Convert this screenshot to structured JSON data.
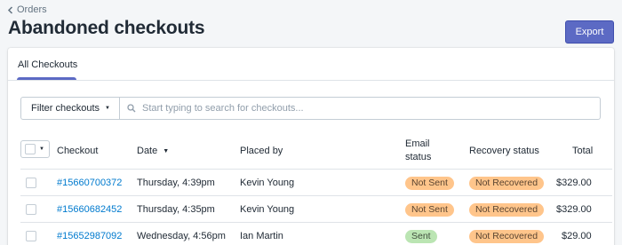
{
  "breadcrumb": {
    "label": "Orders"
  },
  "page": {
    "title": "Abandoned checkouts"
  },
  "actions": {
    "export_label": "Export"
  },
  "tabs": [
    {
      "label": "All Checkouts",
      "active": true
    }
  ],
  "filter": {
    "button_label": "Filter checkouts",
    "search_placeholder": "Start typing to search for checkouts...",
    "search_value": ""
  },
  "table": {
    "headers": {
      "checkout": "Checkout",
      "date": "Date",
      "placed_by": "Placed by",
      "email_status_line1": "Email",
      "email_status_line2": "status",
      "recovery_status": "Recovery status",
      "total": "Total"
    },
    "rows": [
      {
        "checkout": "#15660700372",
        "date": "Thursday, 4:39pm",
        "placed_by": "Kevin Young",
        "email_status": "Not Sent",
        "recovery_status": "Not Recovered",
        "total": "$329.00"
      },
      {
        "checkout": "#15660682452",
        "date": "Thursday, 4:35pm",
        "placed_by": "Kevin Young",
        "email_status": "Not Sent",
        "recovery_status": "Not Recovered",
        "total": "$329.00"
      },
      {
        "checkout": "#15652987092",
        "date": "Wednesday, 4:56pm",
        "placed_by": "Ian Martin",
        "email_status": "Sent",
        "recovery_status": "Not Recovered",
        "total": "$29.00"
      }
    ]
  },
  "colors": {
    "accent": "#5c6ac4",
    "link": "#007ace",
    "badge_orange": "#ffc58b",
    "badge_green": "#bbe5b3"
  },
  "icons": {
    "back": "chevron-left-icon",
    "search": "search-icon",
    "sort": "caret-down-icon"
  }
}
